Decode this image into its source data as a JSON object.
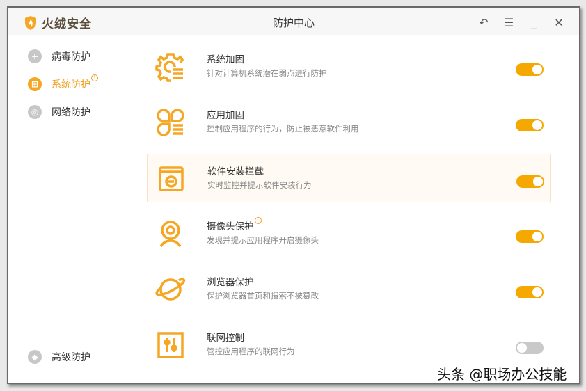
{
  "app": {
    "name": "火绒安全",
    "title": "防护中心"
  },
  "window_controls": [
    "back",
    "menu",
    "minimize",
    "close"
  ],
  "sidebar": {
    "items": [
      {
        "label": "病毒防护",
        "icon": "plus-circle-icon"
      },
      {
        "label": "系统防护",
        "icon": "windows-icon",
        "active": true,
        "badge": "!"
      },
      {
        "label": "网络防护",
        "icon": "globe-icon"
      }
    ],
    "bottom": {
      "label": "高级防护",
      "icon": "diamond-icon"
    }
  },
  "items": [
    {
      "title": "系统加固",
      "desc": "针对计算机系统潜在弱点进行防护",
      "enabled": true,
      "icon": "gear-list-icon"
    },
    {
      "title": "应用加固",
      "desc": "控制应用程序的行为，防止被恶意软件利用",
      "enabled": true,
      "icon": "apps-icon"
    },
    {
      "title": "软件安装拦截",
      "desc": "实时监控并提示软件安装行为",
      "enabled": true,
      "icon": "install-block-icon"
    },
    {
      "title": "摄像头保护",
      "desc": "发现并提示应用程序开启摄像头",
      "enabled": true,
      "icon": "webcam-icon",
      "badge": "!"
    },
    {
      "title": "浏览器保护",
      "desc": "保护浏览器首页和搜索不被篡改",
      "enabled": true,
      "icon": "planet-icon"
    },
    {
      "title": "联网控制",
      "desc": "管控应用程序的联网行为",
      "enabled": false,
      "icon": "sliders-icon"
    }
  ],
  "colors": {
    "accent": "#f5a800",
    "off": "#c9c9c9"
  },
  "watermark": "头条 @职场办公技能"
}
